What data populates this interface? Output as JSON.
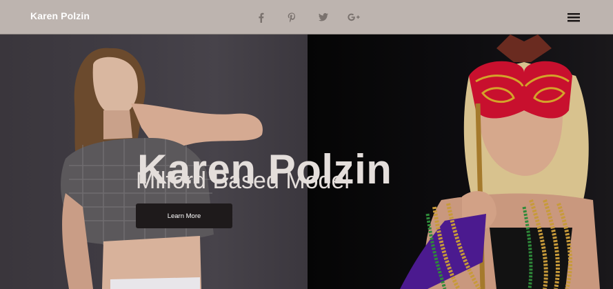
{
  "header": {
    "brand": "Karen Polzin",
    "social_icons": [
      "facebook-icon",
      "pinterest-icon",
      "twitter-icon",
      "google-plus-icon"
    ],
    "menu_icon": "hamburger-menu-icon",
    "background_color": "#bdb4af"
  },
  "hero": {
    "title": "Karen Polzin",
    "subtitle": "Milford Based Model",
    "cta_label": "Learn More",
    "text_color": "#e4dedb",
    "button_color": "#1e1a1b"
  }
}
